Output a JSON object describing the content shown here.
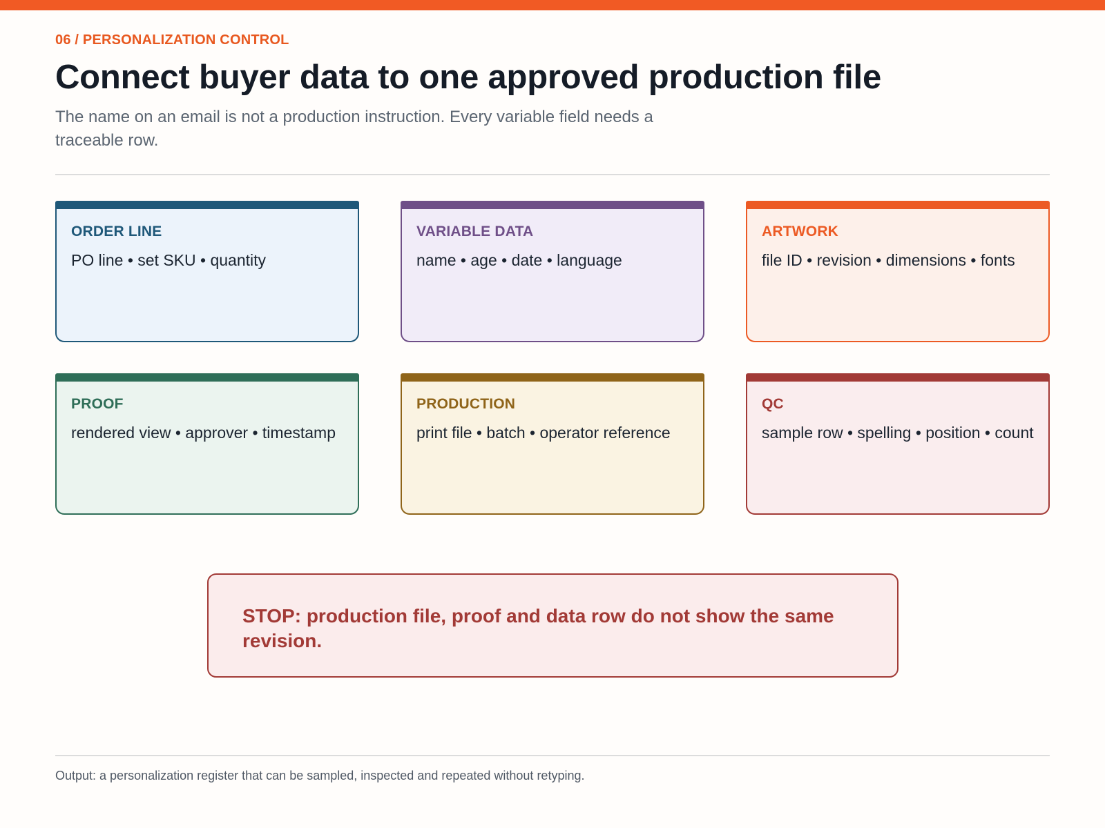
{
  "colors": {
    "accent": "#f15a24",
    "background": "#fffdfb",
    "title": "#151c27",
    "subtitle": "#5b6571",
    "stop_border": "#a23a36",
    "stop_fill": "#fbecec"
  },
  "header": {
    "eyebrow": "06 / PERSONALIZATION CONTROL",
    "title": "Connect buyer data to one approved production file",
    "subtitle": "The name on an email is not a production instruction. Every variable field needs a traceable row."
  },
  "cards": [
    {
      "title": "ORDER LINE",
      "body": "PO line • set SKU • quantity",
      "accent": "#1f5879",
      "fill": "#ecf3fb"
    },
    {
      "title": "VARIABLE DATA",
      "body": "name • age • date • language",
      "accent": "#6f4f88",
      "fill": "#f1ecf8"
    },
    {
      "title": "ARTWORK",
      "body": "file ID • revision • dimensions • fonts",
      "accent": "#ec5a24",
      "fill": "#fdf0ea"
    },
    {
      "title": "PROOF",
      "body": "rendered view • approver • timestamp",
      "accent": "#2f6e58",
      "fill": "#ebf4ef"
    },
    {
      "title": "PRODUCTION",
      "body": "print file • batch • operator reference",
      "accent": "#8f6419",
      "fill": "#faf3e2"
    },
    {
      "title": "QC",
      "body": "sample row • spelling • position • count",
      "accent": "#a23a36",
      "fill": "#faedee"
    }
  ],
  "stop": {
    "text": "STOP: production file, proof and data row do not show the same revision."
  },
  "footer": {
    "text": "Output: a personalization register that can be sampled, inspected and repeated without retyping."
  }
}
